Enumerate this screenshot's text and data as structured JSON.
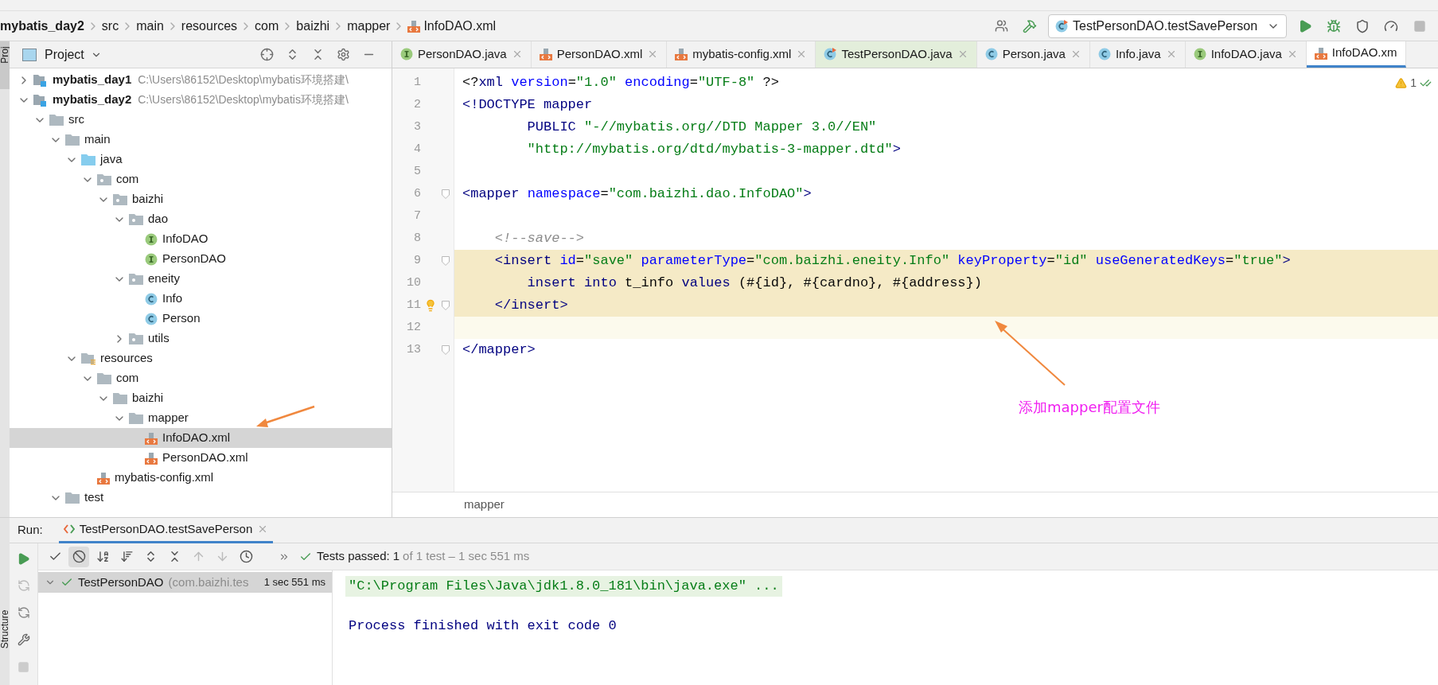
{
  "breadcrumbs": [
    {
      "label": "mybatis_day2",
      "kind": "project"
    },
    {
      "label": "src",
      "kind": "folder"
    },
    {
      "label": "main",
      "kind": "folder"
    },
    {
      "label": "resources",
      "kind": "folder"
    },
    {
      "label": "com",
      "kind": "folder"
    },
    {
      "label": "baizhi",
      "kind": "folder"
    },
    {
      "label": "mapper",
      "kind": "folder"
    },
    {
      "label": "InfoDAO.xml",
      "kind": "xml"
    }
  ],
  "run_config": {
    "label": "TestPersonDAO.testSavePerson"
  },
  "side_tabs": {
    "top": "Proj",
    "bottom": "Structure"
  },
  "project_panel": {
    "title": "Project",
    "tree": [
      {
        "label": "mybatis_day1",
        "path": "C:\\Users\\86152\\Desktop\\mybatis环境搭建\\",
        "kind": "module",
        "expanded": false,
        "selected": false
      },
      {
        "label": "mybatis_day2",
        "path": "C:\\Users\\86152\\Desktop\\mybatis环境搭建\\",
        "kind": "module",
        "expanded": true,
        "selected": false,
        "children": [
          {
            "label": "src",
            "kind": "folder",
            "expanded": true,
            "selected": false,
            "children": [
              {
                "label": "main",
                "kind": "folder",
                "expanded": true,
                "selected": false,
                "children": [
                  {
                    "label": "java",
                    "kind": "source",
                    "expanded": true,
                    "selected": false,
                    "children": [
                      {
                        "label": "com",
                        "kind": "package",
                        "expanded": true,
                        "selected": false,
                        "children": [
                          {
                            "label": "baizhi",
                            "kind": "package",
                            "expanded": true,
                            "selected": false,
                            "children": [
                              {
                                "label": "dao",
                                "kind": "package",
                                "expanded": true,
                                "selected": false,
                                "children": [
                                  {
                                    "label": "InfoDAO",
                                    "kind": "interface",
                                    "selected": false
                                  },
                                  {
                                    "label": "PersonDAO",
                                    "kind": "interface",
                                    "selected": false
                                  }
                                ]
                              },
                              {
                                "label": "eneity",
                                "kind": "package",
                                "expanded": true,
                                "selected": false,
                                "children": [
                                  {
                                    "label": "Info",
                                    "kind": "class",
                                    "selected": false
                                  },
                                  {
                                    "label": "Person",
                                    "kind": "class",
                                    "selected": false
                                  }
                                ]
                              },
                              {
                                "label": "utils",
                                "kind": "package",
                                "expanded": false,
                                "selected": false
                              }
                            ]
                          }
                        ]
                      }
                    ]
                  },
                  {
                    "label": "resources",
                    "kind": "resources",
                    "expanded": true,
                    "selected": false,
                    "children": [
                      {
                        "label": "com",
                        "kind": "folder",
                        "expanded": true,
                        "selected": false,
                        "children": [
                          {
                            "label": "baizhi",
                            "kind": "folder",
                            "expanded": true,
                            "selected": false,
                            "children": [
                              {
                                "label": "mapper",
                                "kind": "folder",
                                "expanded": true,
                                "selected": false,
                                "children": [
                                  {
                                    "label": "InfoDAO.xml",
                                    "kind": "xml",
                                    "selected": true
                                  },
                                  {
                                    "label": "PersonDAO.xml",
                                    "kind": "xml",
                                    "selected": false
                                  }
                                ]
                              }
                            ]
                          }
                        ]
                      },
                      {
                        "label": "mybatis-config.xml",
                        "kind": "xml",
                        "selected": false
                      }
                    ]
                  }
                ]
              },
              {
                "label": "test",
                "kind": "folder",
                "expanded": true,
                "selected": false
              }
            ]
          }
        ]
      }
    ]
  },
  "editor_tabs": [
    {
      "label": "PersonDAO.java",
      "kind": "interface",
      "selected": false
    },
    {
      "label": "PersonDAO.xml",
      "kind": "xml",
      "selected": false
    },
    {
      "label": "mybatis-config.xml",
      "kind": "xml",
      "selected": false
    },
    {
      "label": "TestPersonDAO.java",
      "kind": "test",
      "selected": false
    },
    {
      "label": "Person.java",
      "kind": "class",
      "selected": false
    },
    {
      "label": "Info.java",
      "kind": "class",
      "selected": false
    },
    {
      "label": "InfoDAO.java",
      "kind": "interface",
      "selected": false
    },
    {
      "label": "InfoDAO.xm",
      "kind": "xml",
      "selected": true
    }
  ],
  "editor": {
    "warning_count": "1",
    "lines": [
      {
        "number": "1",
        "highlighted": false,
        "current": false,
        "fold": false,
        "bulb": false,
        "tokens": [
          {
            "text": "<?",
            "kind": "plain"
          },
          {
            "text": "xml ",
            "kind": "tag"
          },
          {
            "text": "version",
            "kind": "attr"
          },
          {
            "text": "=",
            "kind": "plain"
          },
          {
            "text": "\"1.0\" ",
            "kind": "value"
          },
          {
            "text": "encoding",
            "kind": "attr"
          },
          {
            "text": "=",
            "kind": "plain"
          },
          {
            "text": "\"UTF-8\" ",
            "kind": "value"
          },
          {
            "text": "?>",
            "kind": "plain"
          }
        ]
      },
      {
        "number": "2",
        "highlighted": false,
        "current": false,
        "fold": false,
        "bulb": false,
        "tokens": [
          {
            "text": "<!DOCTYPE mapper",
            "kind": "tag"
          }
        ]
      },
      {
        "number": "3",
        "highlighted": false,
        "current": false,
        "fold": false,
        "bulb": false,
        "tokens": [
          {
            "text": "        PUBLIC ",
            "kind": "tag"
          },
          {
            "text": "\"-//mybatis.org//DTD Mapper 3.0//EN\"",
            "kind": "value"
          }
        ]
      },
      {
        "number": "4",
        "highlighted": false,
        "current": false,
        "fold": false,
        "bulb": false,
        "tokens": [
          {
            "text": "        \"http://mybatis.org/dtd/mybatis-3-mapper.dtd\"",
            "kind": "value"
          },
          {
            "text": ">",
            "kind": "tag"
          }
        ]
      },
      {
        "number": "5",
        "highlighted": false,
        "current": false,
        "fold": false,
        "bulb": false
      },
      {
        "number": "6",
        "highlighted": false,
        "current": false,
        "fold": true,
        "bulb": false,
        "tokens": [
          {
            "text": "<mapper ",
            "kind": "tag"
          },
          {
            "text": "namespace",
            "kind": "attr"
          },
          {
            "text": "=",
            "kind": "plain"
          },
          {
            "text": "\"com.baizhi.dao.InfoDAO\"",
            "kind": "value"
          },
          {
            "text": ">",
            "kind": "tag"
          }
        ]
      },
      {
        "number": "7",
        "highlighted": false,
        "current": false,
        "fold": false,
        "bulb": false
      },
      {
        "number": "8",
        "highlighted": false,
        "current": false,
        "fold": false,
        "bulb": false,
        "tokens": [
          {
            "text": "    <!--save-->",
            "kind": "comment"
          }
        ]
      },
      {
        "number": "9",
        "highlighted": true,
        "current": false,
        "fold": true,
        "bulb": false,
        "tokens": [
          {
            "text": "    <insert ",
            "kind": "tag"
          },
          {
            "text": "id",
            "kind": "attr"
          },
          {
            "text": "=",
            "kind": "plain"
          },
          {
            "text": "\"save\" ",
            "kind": "value"
          },
          {
            "text": "parameterType",
            "kind": "attr"
          },
          {
            "text": "=",
            "kind": "plain"
          },
          {
            "text": "\"com.baizhi.eneity.Info\" ",
            "kind": "value"
          },
          {
            "text": "keyProperty",
            "kind": "attr"
          },
          {
            "text": "=",
            "kind": "plain"
          },
          {
            "text": "\"id\" ",
            "kind": "value"
          },
          {
            "text": "useGeneratedKeys",
            "kind": "attr"
          },
          {
            "text": "=",
            "kind": "plain"
          },
          {
            "text": "\"true\"",
            "kind": "value"
          },
          {
            "text": ">",
            "kind": "tag"
          }
        ]
      },
      {
        "number": "10",
        "highlighted": true,
        "current": false,
        "fold": false,
        "bulb": false,
        "tokens": [
          {
            "text": "        insert into ",
            "kind": "tag"
          },
          {
            "text": "t_info ",
            "kind": "plain"
          },
          {
            "text": "values ",
            "kind": "tag"
          },
          {
            "text": "(#{id}, #{cardno}, #{address})",
            "kind": "plain"
          }
        ]
      },
      {
        "number": "11",
        "highlighted": true,
        "current": false,
        "fold": true,
        "bulb": true,
        "tokens": [
          {
            "text": "    </insert>",
            "kind": "tag"
          }
        ]
      },
      {
        "number": "12",
        "highlighted": false,
        "current": true,
        "fold": false,
        "bulb": false
      },
      {
        "number": "13",
        "highlighted": false,
        "current": false,
        "fold": true,
        "bulb": false,
        "tokens": [
          {
            "text": "</mapper>",
            "kind": "tag"
          }
        ]
      }
    ],
    "breadcrumb": "mapper"
  },
  "annotation": {
    "text": "添加mapper配置文件"
  },
  "run_panel": {
    "title": "Run:",
    "tab": "TestPersonDAO.testSavePerson",
    "status_label": "Tests passed:",
    "status_count": "1",
    "status_detail": "of 1 test – 1 sec 551 ms",
    "tests": [
      {
        "name": "TestPersonDAO",
        "package": "(com.baizhi.tes",
        "time": "1 sec 551 ms",
        "passed": true,
        "selected": true
      }
    ],
    "console": [
      {
        "text": "\"C:\\Program Files\\Java\\jdk1.8.0_181\\bin\\java.exe\" ...",
        "kind": "command"
      },
      {
        "text": "Process finished with exit code 0",
        "kind": "exit"
      }
    ]
  }
}
